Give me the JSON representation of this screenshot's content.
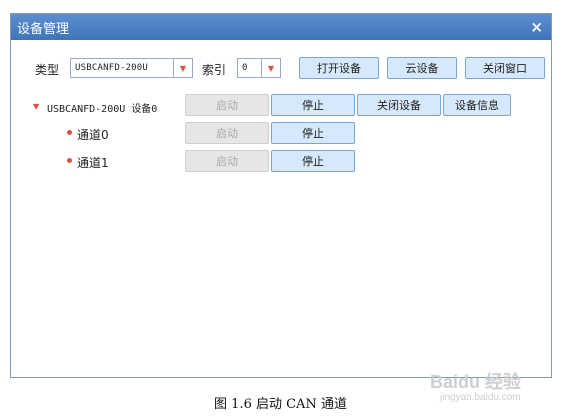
{
  "window": {
    "title": "设备管理",
    "close_glyph": "×"
  },
  "form": {
    "type_label": "类型",
    "type_value": "USBCANFD-200U",
    "index_label": "索引",
    "index_value": "0"
  },
  "toolbar": {
    "open_device": "打开设备",
    "cloud_device": "云设备",
    "close_window": "关闭窗口"
  },
  "tree": {
    "device_label": "USBCANFD-200U 设备0",
    "device_buttons": {
      "start": "启动",
      "stop": "停止",
      "close_device": "关闭设备",
      "device_info": "设备信息"
    },
    "channels": [
      {
        "label": "通道0",
        "start": "启动",
        "stop": "停止"
      },
      {
        "label": "通道1",
        "start": "启动",
        "stop": "停止"
      }
    ]
  },
  "caption": "图 1.6   启动 CAN 通道",
  "watermark": {
    "text": "Baidu 经验",
    "sub": "jingyan.baidu.com"
  },
  "colors": {
    "title_bar": "#4a7fc1",
    "button_bg": "#d6e8fb",
    "accent_red": "#e05040"
  }
}
